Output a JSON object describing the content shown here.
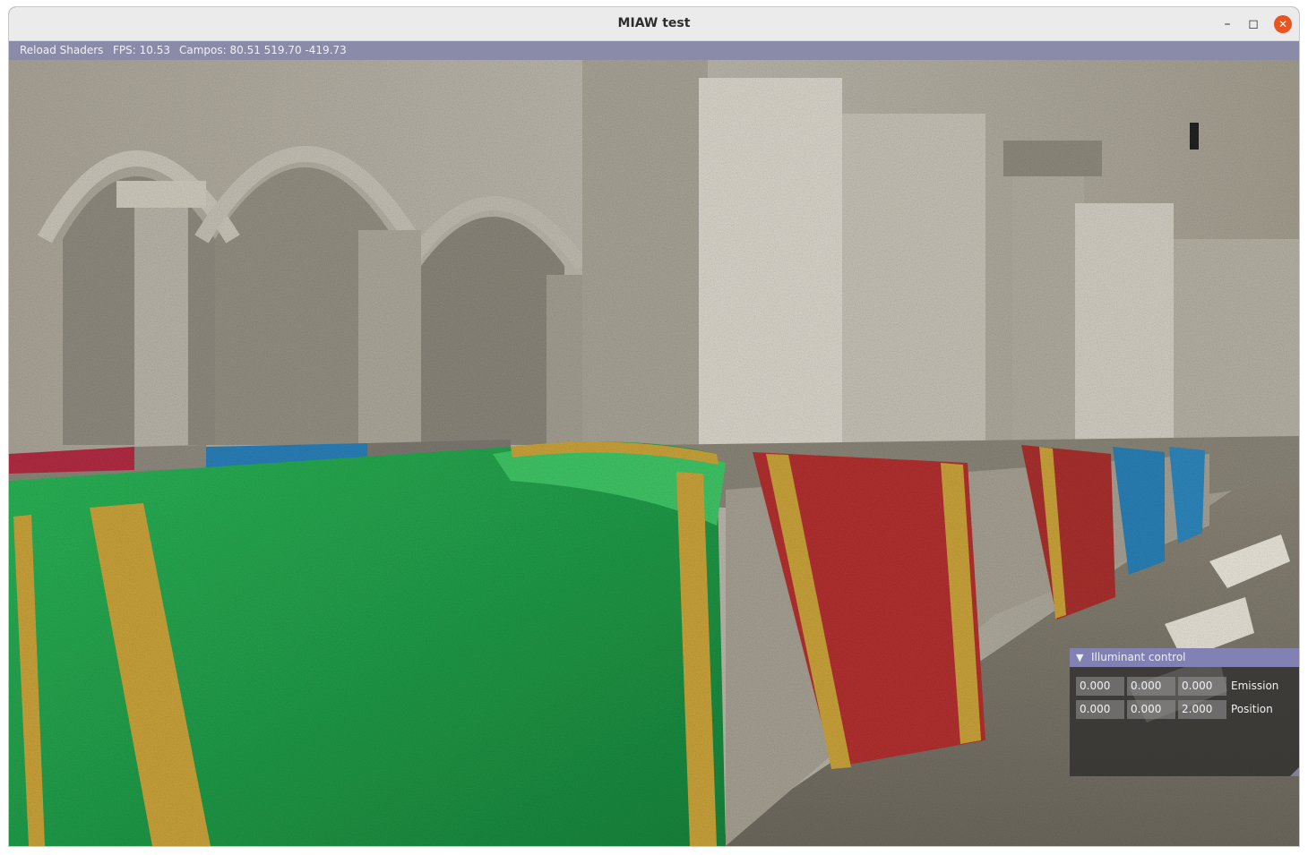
{
  "window": {
    "title": "MIAW test",
    "controls": {
      "minimize": "–",
      "maximize": "◻",
      "close": "✕"
    }
  },
  "menubar": {
    "reload_label": "Reload Shaders",
    "fps": "FPS: 10.53",
    "campos": "Campos: 80.51 519.70 -419.73"
  },
  "panel": {
    "title": "Illuminant control",
    "emission": {
      "label": "Emission",
      "values": [
        "0.000",
        "0.000",
        "0.000"
      ]
    },
    "position": {
      "label": "Position",
      "values": [
        "0.000",
        "0.000",
        "2.000"
      ]
    }
  },
  "colors": {
    "menubar": "#8a8aa9",
    "panel_header": "#8181b4",
    "close_button": "#e95420",
    "cloth_green": "#1f9a45",
    "cloth_red": "#b23030",
    "cloth_blue": "#2a7fb8",
    "gold_trim": "#c9a23a",
    "stone": "#a8a293"
  }
}
